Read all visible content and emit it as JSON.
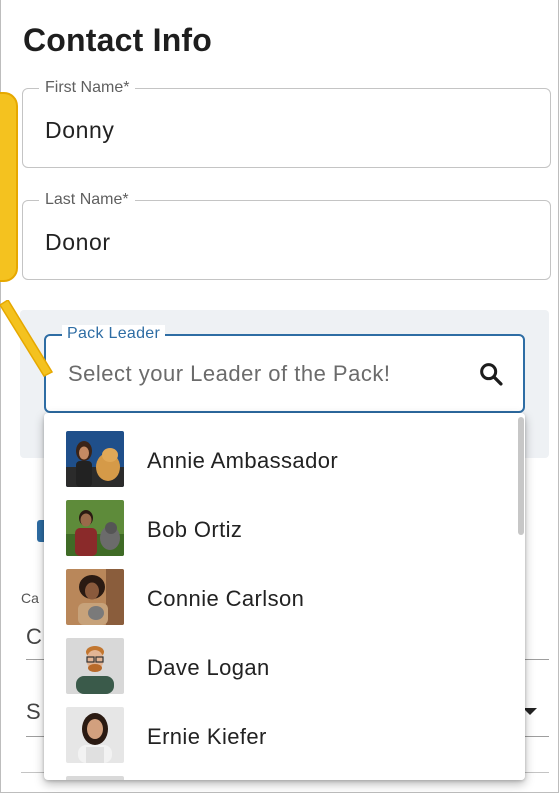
{
  "form": {
    "title": "Contact Info",
    "first_name": {
      "label": "First Name*",
      "value": "Donny"
    },
    "last_name": {
      "label": "Last Name*",
      "value": "Donor"
    },
    "pack_leader": {
      "label": "Pack Leader",
      "placeholder": "Select your Leader of the Pack!"
    }
  },
  "background_fragments": {
    "caption_fragment": "Ca",
    "field_fragment_1": "C",
    "field_fragment_2": "S"
  },
  "dropdown": {
    "items": [
      {
        "label": "Annie Ambassador"
      },
      {
        "label": "Bob Ortiz"
      },
      {
        "label": "Connie Carlson"
      },
      {
        "label": "Dave Logan"
      },
      {
        "label": "Ernie Kiefer"
      }
    ]
  },
  "colors": {
    "callout": "#f4c21f",
    "accent": "#2e6da4",
    "section_bg": "#eef1f4"
  }
}
